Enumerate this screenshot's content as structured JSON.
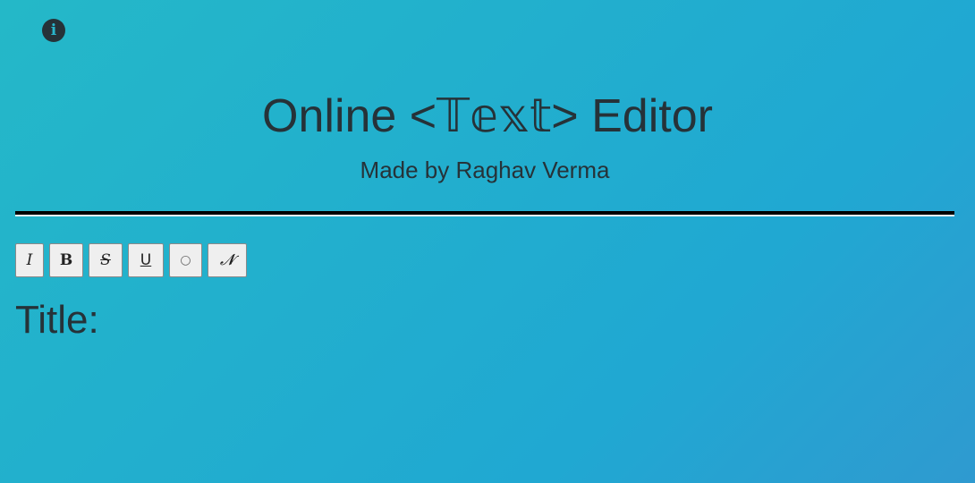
{
  "header": {
    "info_icon": "info-icon",
    "info_glyph": "i",
    "title": "Online <𝕋𝕖𝕩𝕥> Editor",
    "subtitle": "Made by Raghav Verma"
  },
  "toolbar": {
    "buttons": [
      {
        "label": "I",
        "name": "italic-button"
      },
      {
        "label": "B",
        "name": "bold-button"
      },
      {
        "label": "S",
        "name": "strikethrough-button"
      },
      {
        "label": "U",
        "name": "underline-button"
      },
      {
        "label": "○",
        "name": "circle-button"
      },
      {
        "label": "𝓝",
        "name": "normal-text-button"
      }
    ]
  },
  "editor": {
    "title_label": "Title:"
  }
}
